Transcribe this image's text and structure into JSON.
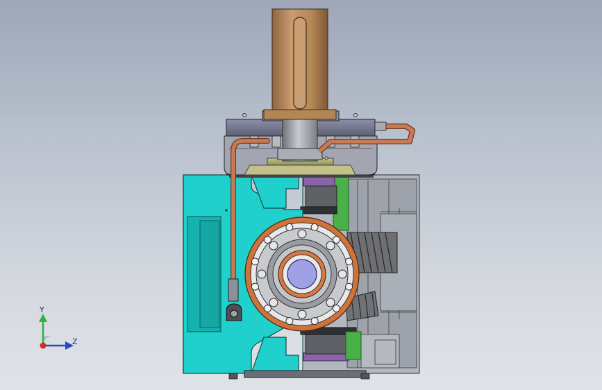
{
  "viewport": {
    "background_top": "#9ea6b8",
    "background_bottom": "#dfe2e6"
  },
  "colors": {
    "housing_cyan": "#1fd0cc",
    "shaft_bronze": "#b98a5e",
    "copper_pipe": "#c87a55",
    "flange_orange": "#d0733a",
    "steel_gray": "#9aa0a8",
    "bearing_blue": "#9fa0e6",
    "green_part": "#49b04a",
    "purple_part": "#8a64a8"
  },
  "triad": {
    "y_label": "Y",
    "z_label": "Z",
    "y_color": "#2bb24a",
    "z_color": "#2a46c8",
    "origin_color": "#d42a2a"
  }
}
